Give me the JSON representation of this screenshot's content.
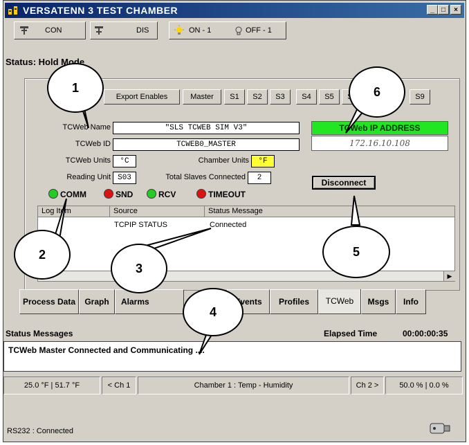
{
  "window": {
    "title": "VERSATENN 3 TEST CHAMBER",
    "min_label": "_",
    "max_label": "□",
    "close_label": "×"
  },
  "toolbar": {
    "con": "CON",
    "dis": "DIS",
    "on": "ON - 1",
    "off": "OFF - 1"
  },
  "status_mode": "Status: Hold Mode",
  "top_buttons": [
    "Export Enables",
    "Master",
    "S1",
    "S2",
    "S3",
    "S4",
    "S5",
    "S6",
    "S9"
  ],
  "form": {
    "name_label": "TCWeb Name",
    "name_value": "\"SLS TCWEB SIM V3\"",
    "id_label": "TCWeb ID",
    "id_value": "TCWEB0_MASTER",
    "units_label": "TCWeb Units",
    "units_value": "°C",
    "chamber_units_label": "Chamber Units",
    "chamber_units_value": "°F",
    "reading_unit_label": "Reading Unit",
    "reading_unit_value": "S03",
    "total_slaves_label": "Total Slaves Connected",
    "total_slaves_value": "2",
    "ip_header": "TCWeb IP ADDRESS",
    "ip_value": "172.16.10.108",
    "disconnect_label": "Disconnect"
  },
  "indicators": [
    {
      "label": "COMM",
      "color": "#22cc22"
    },
    {
      "label": "SND",
      "color": "#dd1111"
    },
    {
      "label": "RCV",
      "color": "#22cc22"
    },
    {
      "label": "TIMEOUT",
      "color": "#dd1111"
    }
  ],
  "log": {
    "headers": [
      "Log Item",
      "Source",
      "Status Message"
    ],
    "rows": [
      [
        "",
        "TCPIP STATUS",
        "Connected"
      ]
    ]
  },
  "tabs": [
    "Process Data",
    "Graph",
    "Alarms",
    "Events",
    "Profiles",
    "TCWeb",
    "Msgs",
    "Info"
  ],
  "status_messages": {
    "title": "Status Messages",
    "elapsed_label": "Elapsed Time",
    "elapsed_value": "00:00:00:35",
    "message": "TCWeb Master Connected and Communicating ...."
  },
  "status_bar": {
    "temps": "25.0 °F | 51.7 °F",
    "ch1": "< Ch 1",
    "chamber": "Chamber 1 : Temp - Humidity",
    "ch2": "Ch 2 >",
    "percent": "50.0 % | 0.0 %"
  },
  "rs232": "RS232 : Connected",
  "callouts": [
    "1",
    "2",
    "3",
    "4",
    "5",
    "6"
  ],
  "colors": {
    "title_bar": "#08246b",
    "ip_header_bg": "#22e622",
    "chamber_units_bg": "#ffff33"
  }
}
